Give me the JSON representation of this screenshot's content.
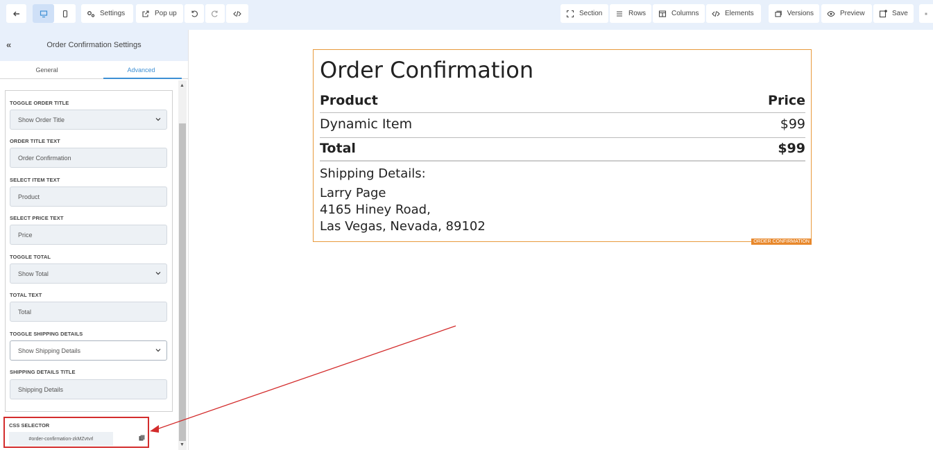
{
  "toolbar": {
    "settings_label": "Settings",
    "popup_label": "Pop up",
    "section_label": "Section",
    "rows_label": "Rows",
    "columns_label": "Columns",
    "elements_label": "Elements",
    "versions_label": "Versions",
    "preview_label": "Preview",
    "save_label": "Save"
  },
  "sidebar": {
    "title": "Order Confirmation Settings",
    "tabs": [
      "General",
      "Advanced"
    ],
    "fields": [
      {
        "label": "TOGGLE ORDER TITLE",
        "value": "Show Order Title",
        "type": "select"
      },
      {
        "label": "ORDER TITLE TEXT",
        "value": "Order Confirmation",
        "type": "text"
      },
      {
        "label": "SELECT ITEM TEXT",
        "value": "Product",
        "type": "text"
      },
      {
        "label": "SELECT PRICE TEXT",
        "value": "Price",
        "type": "text"
      },
      {
        "label": "TOGGLE TOTAL",
        "value": "Show Total",
        "type": "select"
      },
      {
        "label": "TOTAL TEXT",
        "value": "Total",
        "type": "text"
      },
      {
        "label": "TOGGLE SHIPPING DETAILS",
        "value": "Show Shipping Details",
        "type": "select"
      },
      {
        "label": "SHIPPING DETAILS TITLE",
        "value": "Shipping Details",
        "type": "text"
      }
    ],
    "css_selector": {
      "label": "CSS SELECTOR",
      "value": "#order-confirmation-zkMZvtvrl"
    }
  },
  "order": {
    "title": "Order Confirmation",
    "product_header": "Product",
    "price_header": "Price",
    "item_name": "Dynamic Item",
    "item_price": "$99",
    "total_label": "Total",
    "total_value": "$99",
    "shipping_title": "Shipping Details:",
    "shipping_lines": [
      "Larry Page",
      "4165 Hiney Road,",
      "Las Vegas, Nevada, 89102"
    ],
    "element_tag": "ORDER CONFIRMATION"
  },
  "colors": {
    "accent": "#3d8fd4",
    "toolbar_bg": "#e8f0fb",
    "element_border": "#e89a3c",
    "annotation": "#d32c2c"
  }
}
